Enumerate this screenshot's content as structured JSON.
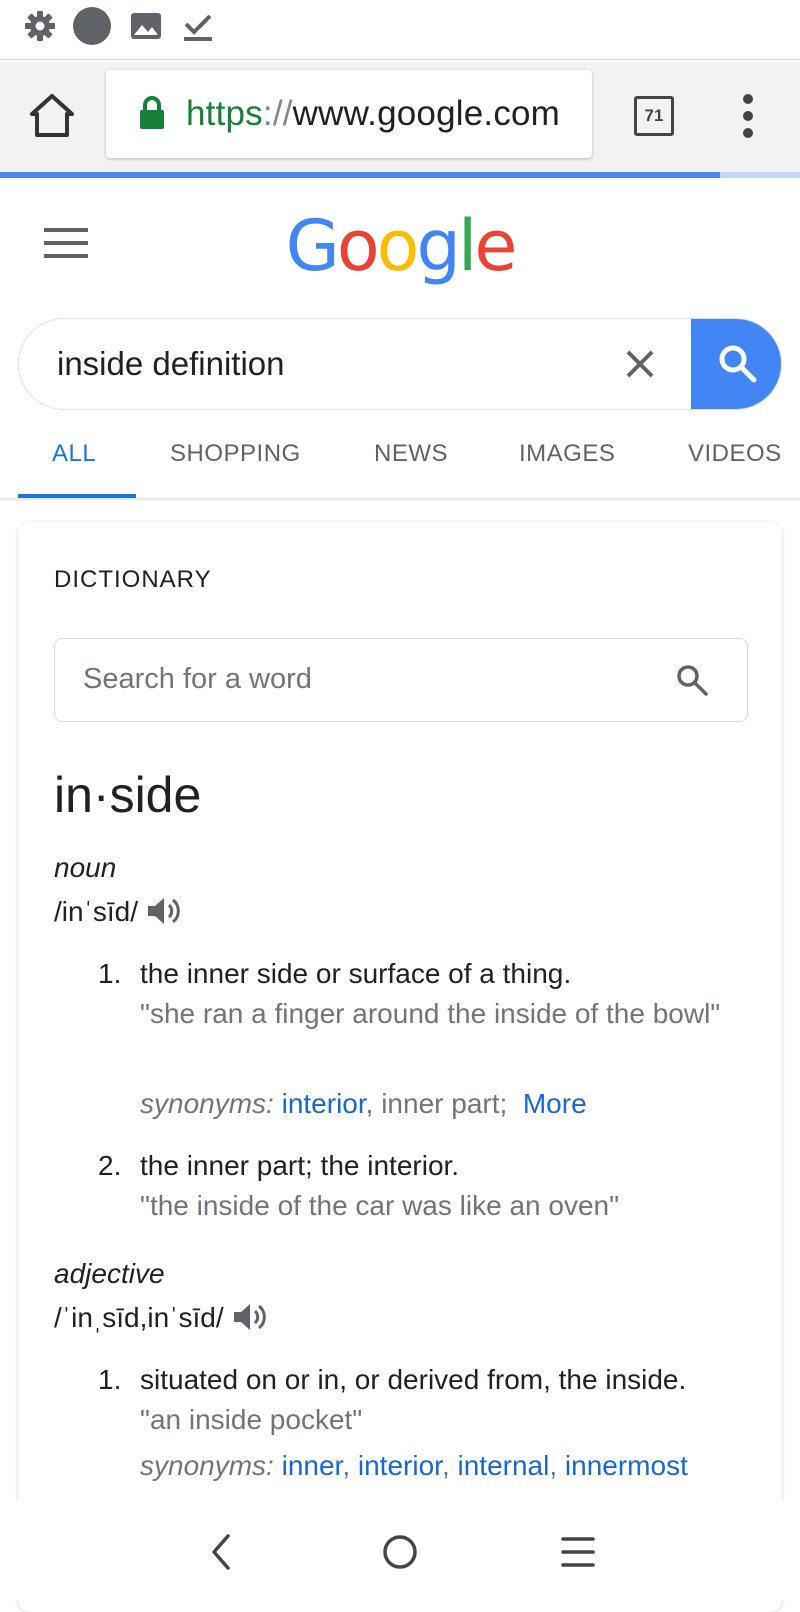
{
  "status_bar": {
    "icons": [
      "gear-icon",
      "circle-icon",
      "image-icon",
      "download-check-icon"
    ]
  },
  "browser": {
    "url_scheme": "https",
    "url_separator": "://",
    "url_host": "www.google.com",
    "tab_count": "71",
    "load_progress": 0.9
  },
  "google": {
    "logo_letters": [
      {
        "char": "G",
        "color": "#4285F4"
      },
      {
        "char": "o",
        "color": "#EA4335"
      },
      {
        "char": "o",
        "color": "#FBBC05"
      },
      {
        "char": "g",
        "color": "#4285F4"
      },
      {
        "char": "l",
        "color": "#34A853"
      },
      {
        "char": "e",
        "color": "#EA4335"
      }
    ],
    "search_query": "inside definition",
    "tabs": [
      "ALL",
      "SHOPPING",
      "NEWS",
      "IMAGES",
      "VIDEOS"
    ],
    "active_tab": "ALL"
  },
  "dictionary": {
    "heading": "DICTIONARY",
    "search_placeholder": "Search for a word",
    "headword": "in·side",
    "noun": {
      "pos": "noun",
      "pronunciation": "/inˈsīd/",
      "definitions": [
        {
          "number": "1.",
          "text": "the inner side or surface of a thing.",
          "example": "\"she ran a finger around the inside of the bowl\"",
          "synonyms_label": "synonyms:",
          "synonym_link": "interior",
          "synonym_rest": ", inner part;",
          "more_label": "More"
        },
        {
          "number": "2.",
          "text": "the inner part; the interior.",
          "example": "\"the inside of the car was like an oven\""
        }
      ]
    },
    "adjective": {
      "pos": "adjective",
      "pronunciation": "/ˈinˌsīd,inˈsīd/",
      "definitions": [
        {
          "number": "1.",
          "text": "situated on or in, or derived from, the inside.",
          "example": "\"an inside pocket\"",
          "synonyms_label": "synonyms:",
          "synonym_links": [
            "inner",
            "interior",
            "internal",
            "innermost"
          ],
          "synonym_sep": ", "
        }
      ]
    }
  },
  "colors": {
    "accent_blue": "#1a73e8",
    "search_button": "#4285f4",
    "secure_green": "#188038"
  }
}
